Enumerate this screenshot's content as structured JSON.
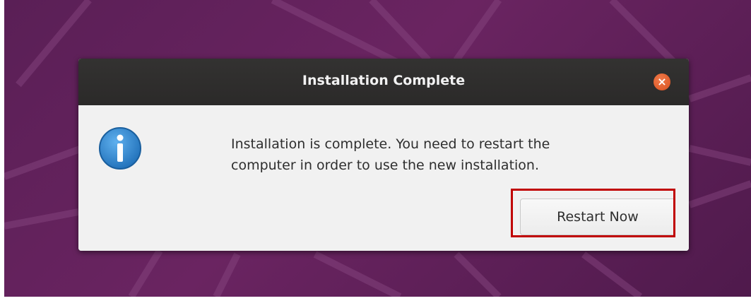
{
  "dialog": {
    "title": "Installation Complete",
    "close_icon": "close-icon",
    "close_glyph": "×",
    "info_icon": "info-icon",
    "message_line1": "Installation is complete. You need to restart the",
    "message_line2": "computer in order to use the new installation.",
    "restart_label": "Restart Now"
  },
  "colors": {
    "wallpaper": "#5e2059",
    "titlebar": "#2f2e2d",
    "close_button": "#e95420",
    "info_icon": "#2a7fc9",
    "highlight": "#c00000"
  }
}
